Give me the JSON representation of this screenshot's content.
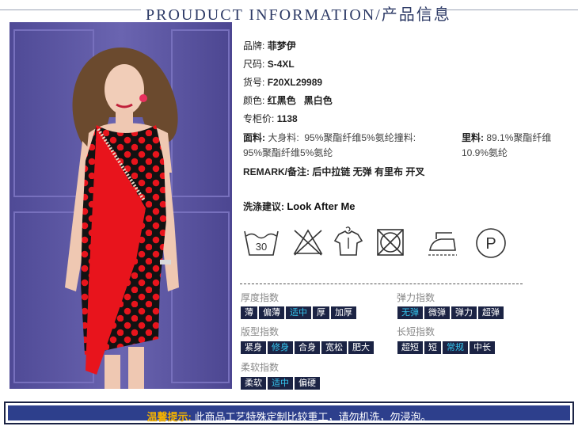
{
  "header": {
    "title": "PROUDUCT INFORMATION/产品信息"
  },
  "product": {
    "brand_label": "品牌:",
    "brand": "菲梦伊",
    "size_label": "尺码:",
    "size": "S-4XL",
    "sku_label": "货号:",
    "sku": "F20XL29989",
    "color_label": "颜色:",
    "color": "红黑色   黑白色",
    "price_label": "专柜价:",
    "price": "1138",
    "fabric_label": "面料:",
    "fabric_line1": "大身料:  95%聚酯纤维5%氨纶撞料:",
    "fabric_line2": "95%聚酯纤维5%氨纶",
    "lining_label": "里料:",
    "lining_line1": "89.1%聚酯纤维",
    "lining_line2": "10.9%氨纶",
    "remark_label": "REMARK/备注:",
    "remark": "后中拉链 无弹 有里布 开叉"
  },
  "care": {
    "label": "洗涤建议:",
    "value": "Look After Me",
    "wash_temp": "30",
    "dry_clean_letter": "P",
    "icons": [
      "wash-30-icon",
      "no-bleach-icon",
      "hang-dry-icon",
      "no-tumble-dry-icon",
      "iron-icon",
      "dry-clean-p-icon"
    ]
  },
  "indices": {
    "thickness": {
      "title": "厚度指数",
      "options": [
        "薄",
        "偏薄",
        "适中",
        "厚",
        "加厚"
      ],
      "selected": "适中"
    },
    "elasticity": {
      "title": "弹力指数",
      "options": [
        "无弹",
        "微弹",
        "弹力",
        "超弹"
      ],
      "selected": "无弹"
    },
    "fit": {
      "title": "版型指数",
      "options": [
        "紧身",
        "修身",
        "合身",
        "宽松",
        "肥大"
      ],
      "selected": "修身"
    },
    "length": {
      "title": "长短指数",
      "options": [
        "超短",
        "短",
        "常规",
        "中长"
      ],
      "selected": "常规"
    },
    "softness": {
      "title": "柔软指数",
      "options": [
        "柔软",
        "适中",
        "偏硬"
      ],
      "selected": "适中"
    }
  },
  "footer": {
    "warn": "温馨提示:",
    "text": "此商品工艺特殊定制比较重工，请勿机洗，勿浸泡。"
  },
  "colors": {
    "navy": "#1b2344",
    "chip_selected": "#35c6ef",
    "footer_bg": "#2d3f8c",
    "warn": "#f5b300",
    "dress_red": "#e8141c",
    "backdrop": "#5b55a0"
  }
}
